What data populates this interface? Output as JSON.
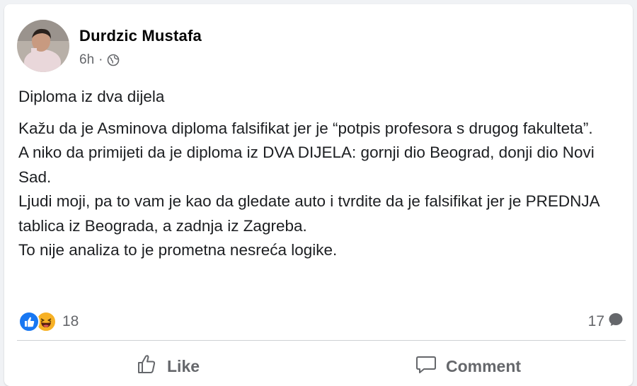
{
  "post": {
    "author": "Durdzic Mustafa",
    "time": "6h",
    "separator": "·",
    "title": "Diploma iz dva dijela",
    "paragraphs": [
      "Kažu da je Asminova diploma falsifikat jer je “potpis profesora s drugog fakulteta”.",
      "A niko da primijeti da je diploma iz DVA DIJELA: gornji dio Beograd, donji dio Novi Sad.",
      "Ljudi moji, pa to vam je kao da gledate auto i tvrdite da je falsifikat jer je PREDNJA tablica iz Beograda, a zadnja iz Zagreba.",
      "To nije analiza  to je prometna nesreća logike."
    ]
  },
  "stats": {
    "reactions_count": "18",
    "comments_count": "17",
    "reaction_icons": [
      "like-icon",
      "haha-icon"
    ]
  },
  "actions": {
    "like": "Like",
    "comment": "Comment"
  },
  "icons": {
    "privacy": "globe-icon",
    "comment_bubble": "comment-bubble-icon"
  },
  "colors": {
    "like_blue": "#1877f2",
    "haha_yellow": "#f7b125",
    "secondary_text": "#65676b"
  }
}
